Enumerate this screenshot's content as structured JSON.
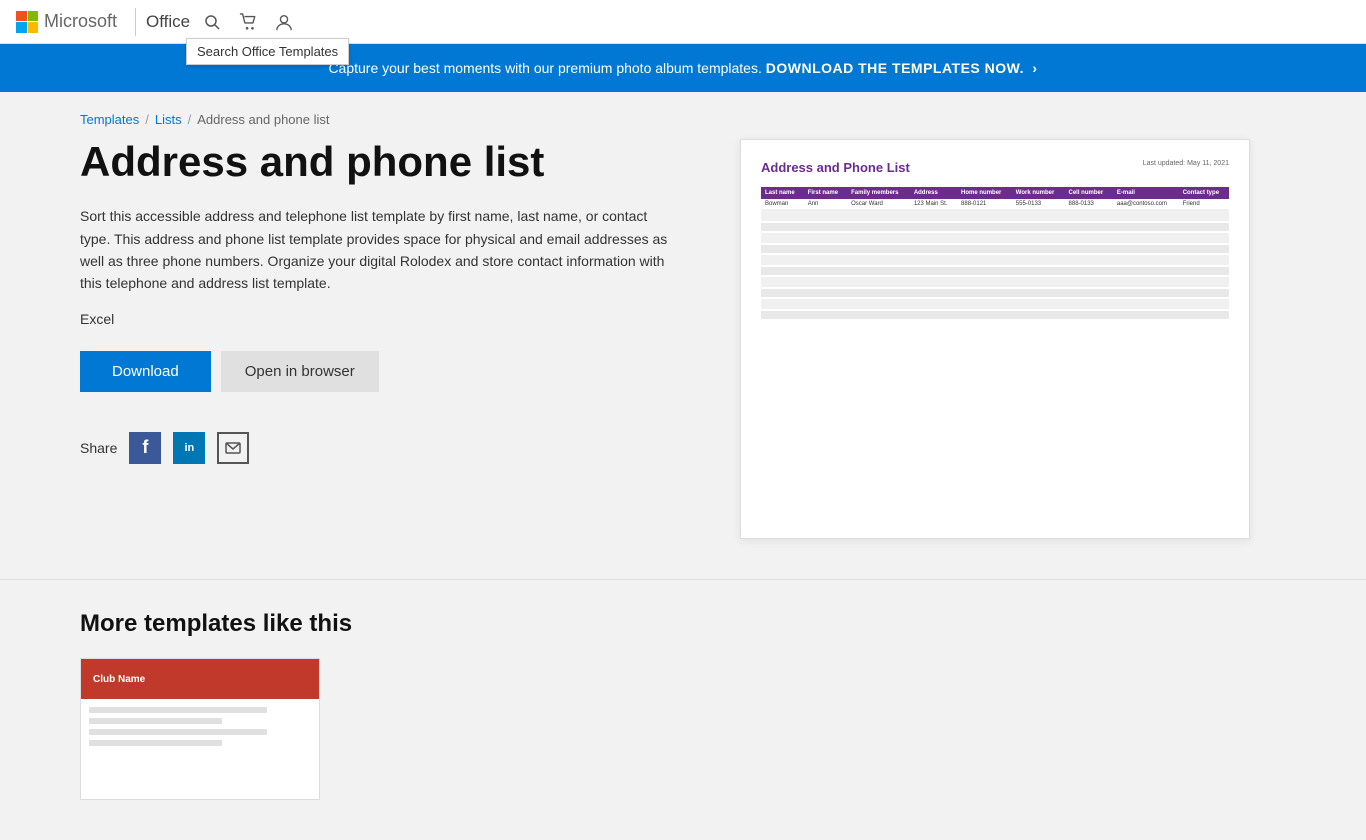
{
  "header": {
    "microsoft_text": "Microsoft",
    "office_text": "Office",
    "search_placeholder": "Search Office Templates",
    "search_tooltip": "Search Office Templates"
  },
  "banner": {
    "text": "Capture your best moments with our premium photo album templates.",
    "cta": "DOWNLOAD THE TEMPLATES NOW.",
    "cta_symbol": "›"
  },
  "breadcrumb": {
    "templates_label": "Templates",
    "lists_label": "Lists",
    "current": "Address and phone list",
    "sep": "/"
  },
  "template": {
    "title": "Address and phone list",
    "description": "Sort this accessible address and telephone list template by first name, last name, or contact type. This address and phone list template provides space for physical and email addresses as well as three phone numbers. Organize your digital Rolodex and store contact information with this telephone and address list template.",
    "app_type": "Excel",
    "download_label": "Download",
    "open_browser_label": "Open in browser",
    "share_label": "Share"
  },
  "preview": {
    "title": "Address and Phone List",
    "last_updated_label": "Last updated:",
    "last_updated_date": "May 11, 2021",
    "columns": [
      "Last name",
      "First name",
      "Family members",
      "Address",
      "Home number",
      "Work number",
      "Cell number",
      "E-mail",
      "Contact type"
    ],
    "sample_row": [
      "Bowman",
      "Ann",
      "Oscar Ward",
      "123 Main St.",
      "888-0121",
      "555-0133",
      "888-0133",
      "aaa@contoso.com",
      "Friend"
    ]
  },
  "more_section": {
    "title": "More templates like this",
    "card1": {
      "club_name": "Club Name"
    }
  },
  "social": {
    "facebook_label": "f",
    "linkedin_label": "in"
  }
}
